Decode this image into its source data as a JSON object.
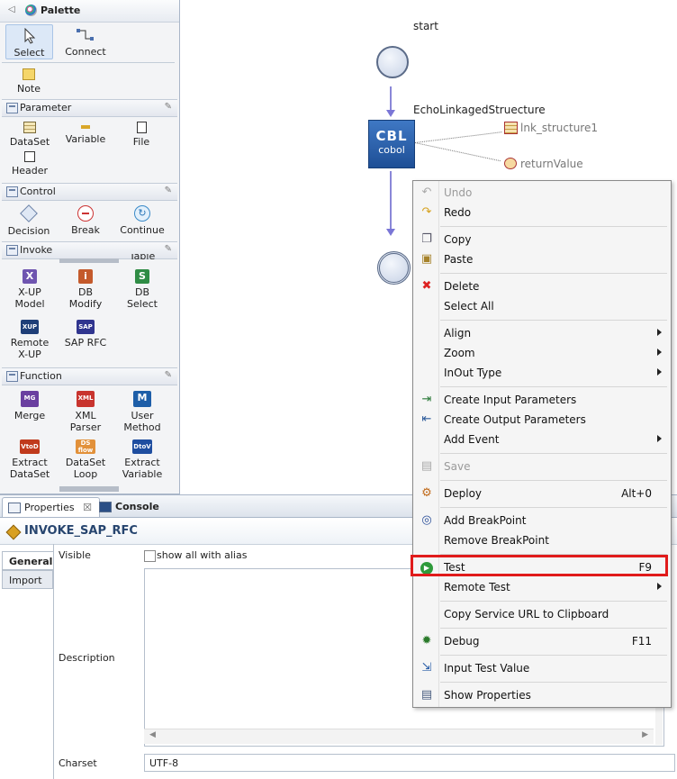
{
  "palette": {
    "title": "Palette",
    "tools": {
      "select": "Select",
      "connect": "Connect",
      "note": "Note"
    },
    "sections": {
      "parameter": {
        "title": "Parameter",
        "items": [
          "DataSet",
          "Variable",
          "File",
          "Header"
        ]
      },
      "control": {
        "title": "Control",
        "items": [
          "Decision",
          "Break",
          "Continue"
        ]
      },
      "invoke": {
        "title": "Invoke",
        "items": [
          "X-UP\nModel",
          "DB\nModify",
          "DB Select",
          "Remote\nX-UP",
          "SAP RFC"
        ],
        "partial": "Table"
      },
      "function": {
        "title": "Function",
        "items": [
          "Merge",
          "XML\nParser",
          "User\nMethod",
          "Extract\nDataSet",
          "DataSet\nLoop",
          "Extract\nVariable"
        ]
      }
    },
    "icon_text": {
      "xup": "X",
      "db": "i",
      "dbsel": "S",
      "xupr": "XUP",
      "sap": "SAP",
      "mg": "MG",
      "xml": "XML",
      "um": "M",
      "vtod": "VtoD",
      "dsloop": "DS\nflow",
      "dtov": "DtoV"
    }
  },
  "canvas": {
    "start_label": "start",
    "node_label": "EchoLinkagedStruecture",
    "node_big": "CBL",
    "node_small": "cobol",
    "out1": "lnk_structure1",
    "out2": "returnValue"
  },
  "bottom": {
    "tabs": {
      "properties": "Properties",
      "close": "☒",
      "console": "Console"
    },
    "title": "INVOKE_SAP_RFC",
    "vtabs": {
      "general": "General",
      "import": "Import"
    },
    "labels": {
      "visible": "Visible",
      "show_alias": "show all with alias",
      "description": "Description",
      "charset": "Charset"
    },
    "charset_value": "UTF-8"
  },
  "menu": {
    "items": {
      "undo": "Undo",
      "redo": "Redo",
      "copy": "Copy",
      "paste": "Paste",
      "delete": "Delete",
      "select_all": "Select All",
      "align": "Align",
      "zoom": "Zoom",
      "inout": "InOut Type",
      "create_input": "Create Input Parameters",
      "create_output": "Create Output Parameters",
      "add_event": "Add Event",
      "save": "Save",
      "deploy": "Deploy",
      "add_bp": "Add BreakPoint",
      "remove_bp": "Remove BreakPoint",
      "test": "Test",
      "remote_test": "Remote Test",
      "copy_url": "Copy Service URL to Clipboard",
      "debug": "Debug",
      "input_test": "Input Test Value",
      "show_props": "Show Properties"
    },
    "keys": {
      "deploy": "Alt+0",
      "test": "F9",
      "debug": "F11"
    }
  },
  "colors": {
    "highlight": "#e01b1b",
    "node": "#2a5ea8",
    "accent": "#27456f"
  }
}
